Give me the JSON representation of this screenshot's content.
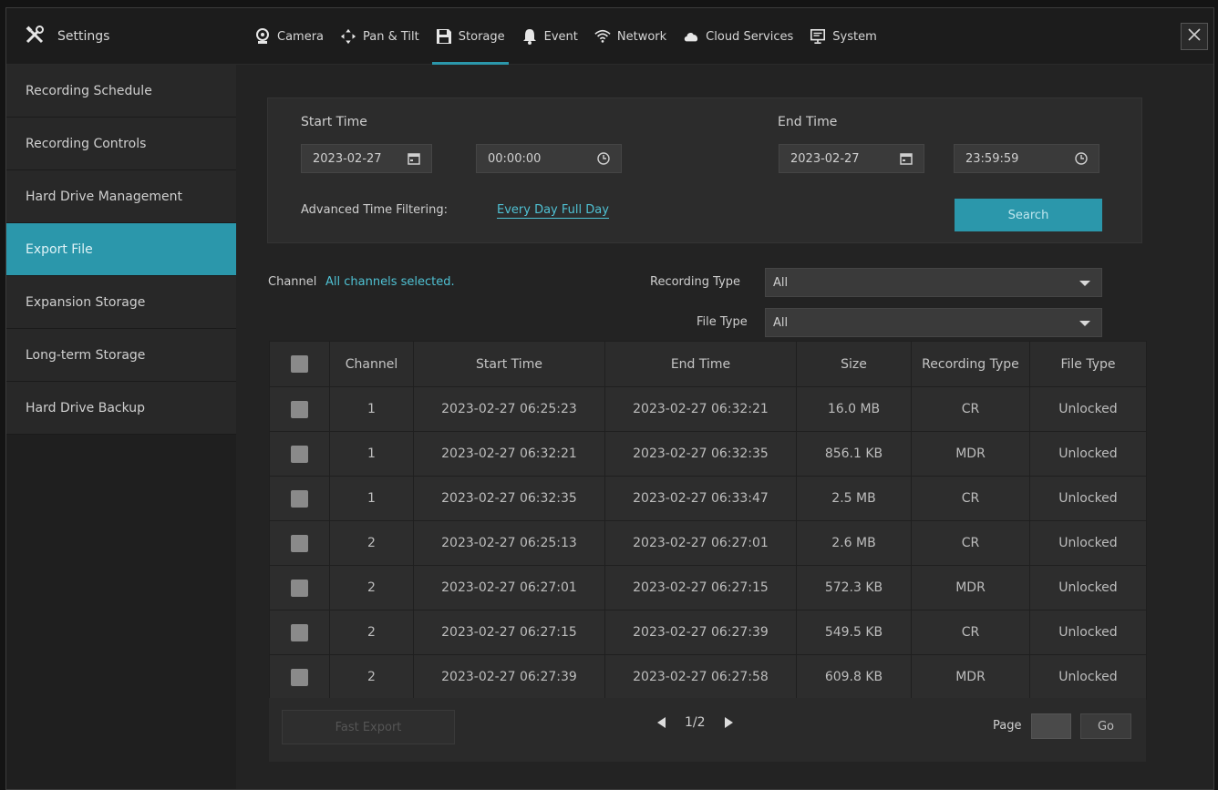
{
  "app": {
    "title": "Settings",
    "title_icon": "tools-icon"
  },
  "tabs": [
    {
      "label": "Camera",
      "icon": "camera-icon",
      "active": false
    },
    {
      "label": "Pan & Tilt",
      "icon": "pan-tilt-icon",
      "active": false
    },
    {
      "label": "Storage",
      "icon": "storage-icon",
      "active": true
    },
    {
      "label": "Event",
      "icon": "bell-icon",
      "active": false
    },
    {
      "label": "Network",
      "icon": "wifi-icon",
      "active": false
    },
    {
      "label": "Cloud Services",
      "icon": "cloud-icon",
      "active": false
    },
    {
      "label": "System",
      "icon": "monitor-icon",
      "active": false
    }
  ],
  "sidebar": {
    "items": [
      {
        "label": "Recording Schedule"
      },
      {
        "label": "Recording Controls"
      },
      {
        "label": "Hard Drive Management"
      },
      {
        "label": "Export File"
      },
      {
        "label": "Expansion Storage"
      },
      {
        "label": "Long-term Storage"
      },
      {
        "label": "Hard Drive Backup"
      }
    ],
    "active_index": 3
  },
  "filter": {
    "start_label": "Start Time",
    "start_date": "2023-02-27",
    "start_time": "00:00:00",
    "end_label": "End Time",
    "end_date": "2023-02-27",
    "end_time": "23:59:59",
    "advanced_label": "Advanced Time Filtering:",
    "advanced_value": "Every Day Full Day",
    "search_label": "Search"
  },
  "channel": {
    "label": "Channel",
    "value": "All channels selected."
  },
  "recording_type": {
    "label": "Recording Type",
    "value": "All"
  },
  "file_type": {
    "label": "File Type",
    "value": "All"
  },
  "table": {
    "headers": [
      "Channel",
      "Start Time",
      "End Time",
      "Size",
      "Recording Type",
      "File Type"
    ],
    "rows": [
      [
        "1",
        "2023-02-27 06:25:23",
        "2023-02-27 06:32:21",
        "16.0 MB",
        "CR",
        "Unlocked"
      ],
      [
        "1",
        "2023-02-27 06:32:21",
        "2023-02-27 06:32:35",
        "856.1 KB",
        "MDR",
        "Unlocked"
      ],
      [
        "1",
        "2023-02-27 06:32:35",
        "2023-02-27 06:33:47",
        "2.5 MB",
        "CR",
        "Unlocked"
      ],
      [
        "2",
        "2023-02-27 06:25:13",
        "2023-02-27 06:27:01",
        "2.6 MB",
        "CR",
        "Unlocked"
      ],
      [
        "2",
        "2023-02-27 06:27:01",
        "2023-02-27 06:27:15",
        "572.3 KB",
        "MDR",
        "Unlocked"
      ],
      [
        "2",
        "2023-02-27 06:27:15",
        "2023-02-27 06:27:39",
        "549.5 KB",
        "CR",
        "Unlocked"
      ],
      [
        "2",
        "2023-02-27 06:27:39",
        "2023-02-27 06:27:58",
        "609.8 KB",
        "MDR",
        "Unlocked"
      ]
    ]
  },
  "footer": {
    "fast_export_label": "Fast Export",
    "page_indicator": "1/2",
    "page_label": "Page",
    "go_label": "Go"
  },
  "colors": {
    "accent": "#2b97ab",
    "link": "#4fc1d3",
    "background": "#232323"
  }
}
